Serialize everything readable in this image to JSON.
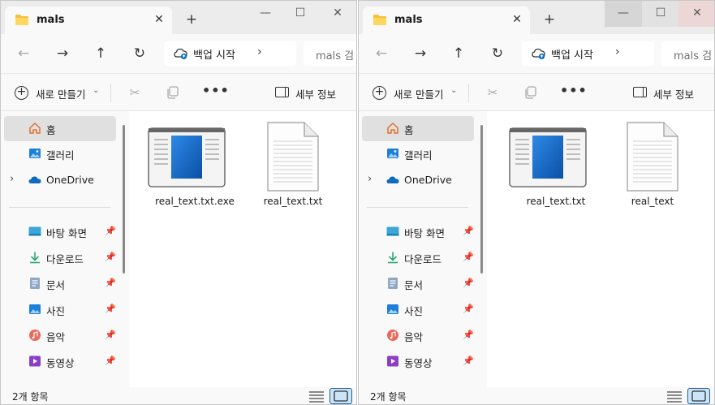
{
  "windows": [
    {
      "tab_title": "mals",
      "close_tab_glyph": "✕",
      "new_tab_glyph": "+",
      "address_text": "백업 시작",
      "search_placeholder": "mals 검",
      "new_label": "새로 만들기",
      "details_label": "세부 정보",
      "sidebar": [
        {
          "label": "홈",
          "icon": "home-icon"
        },
        {
          "label": "갤러리",
          "icon": "gallery-icon"
        },
        {
          "label": "OneDrive",
          "icon": "onedrive-icon"
        },
        {
          "label": "바탕 화면",
          "icon": "desktop-icon"
        },
        {
          "label": "다운로드",
          "icon": "download-icon"
        },
        {
          "label": "문서",
          "icon": "documents-icon"
        },
        {
          "label": "사진",
          "icon": "pictures-icon"
        },
        {
          "label": "음악",
          "icon": "music-icon"
        },
        {
          "label": "동영상",
          "icon": "videos-icon"
        }
      ],
      "files": [
        {
          "name": "real_text.txt.exe",
          "icon": "app-icon"
        },
        {
          "name": "real_text.txt",
          "icon": "text-file-icon"
        }
      ],
      "status": "2개 항목"
    },
    {
      "tab_title": "mals",
      "close_tab_glyph": "✕",
      "new_tab_glyph": "+",
      "address_text": "백업 시작",
      "search_placeholder": "mals 검",
      "new_label": "새로 만들기",
      "details_label": "세부 정보",
      "sidebar": [
        {
          "label": "홈",
          "icon": "home-icon"
        },
        {
          "label": "갤러리",
          "icon": "gallery-icon"
        },
        {
          "label": "OneDrive",
          "icon": "onedrive-icon"
        },
        {
          "label": "바탕 화면",
          "icon": "desktop-icon"
        },
        {
          "label": "다운로드",
          "icon": "download-icon"
        },
        {
          "label": "문서",
          "icon": "documents-icon"
        },
        {
          "label": "사진",
          "icon": "pictures-icon"
        },
        {
          "label": "음악",
          "icon": "music-icon"
        },
        {
          "label": "동영상",
          "icon": "videos-icon"
        }
      ],
      "files": [
        {
          "name": "real_text.txt",
          "icon": "app-icon"
        },
        {
          "name": "real_text",
          "icon": "text-file-icon"
        }
      ],
      "status": "2개 항목"
    }
  ],
  "colors": {
    "accent": "#0067c0",
    "folder_yellow": "#f3c13a",
    "selection_bg": "#e0e0e0"
  }
}
